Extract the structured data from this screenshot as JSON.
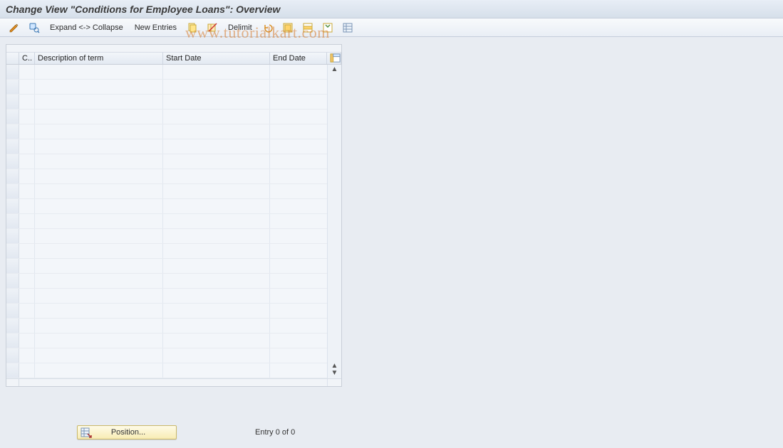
{
  "header": {
    "title": "Change View \"Conditions for Employee Loans\": Overview"
  },
  "toolbar": {
    "expand_collapse_label": "Expand <-> Collapse",
    "new_entries_label": "New Entries",
    "delimit_label": "Delimit"
  },
  "table": {
    "columns": {
      "code": "C..",
      "description": "Description of term",
      "start_date": "Start Date",
      "end_date": "End Date"
    },
    "row_count": 21
  },
  "footer": {
    "position_label": "Position...",
    "entry_text": "Entry 0 of 0"
  },
  "watermark": "www.tutorialkart.com"
}
